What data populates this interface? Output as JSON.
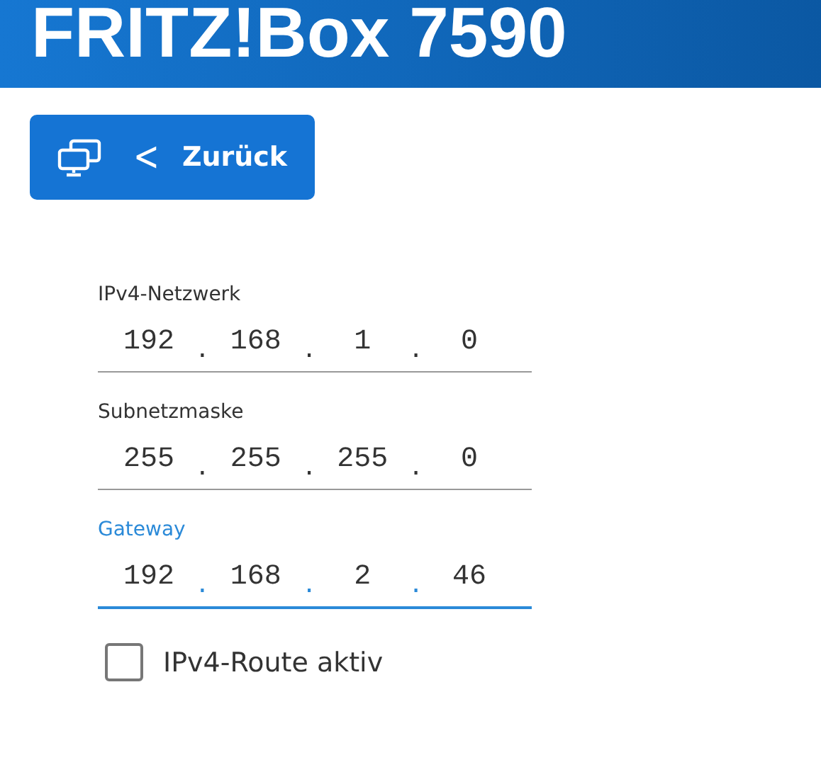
{
  "header": {
    "title": "FRITZ!Box 7590"
  },
  "back_button": {
    "label": "Zurück",
    "chevron": "<"
  },
  "fields": [
    {
      "label": "IPv4-Netzwerk",
      "octets": [
        "192",
        "168",
        "1",
        "0"
      ],
      "separator": ".",
      "focused": false
    },
    {
      "label": "Subnetzmaske",
      "octets": [
        "255",
        "255",
        "255",
        "0"
      ],
      "separator": ".",
      "focused": false
    },
    {
      "label": "Gateway",
      "octets": [
        "192",
        "168",
        "2",
        "46"
      ],
      "separator": ".",
      "focused": true
    }
  ],
  "route_checkbox": {
    "label": "IPv4-Route aktiv",
    "checked": false
  }
}
